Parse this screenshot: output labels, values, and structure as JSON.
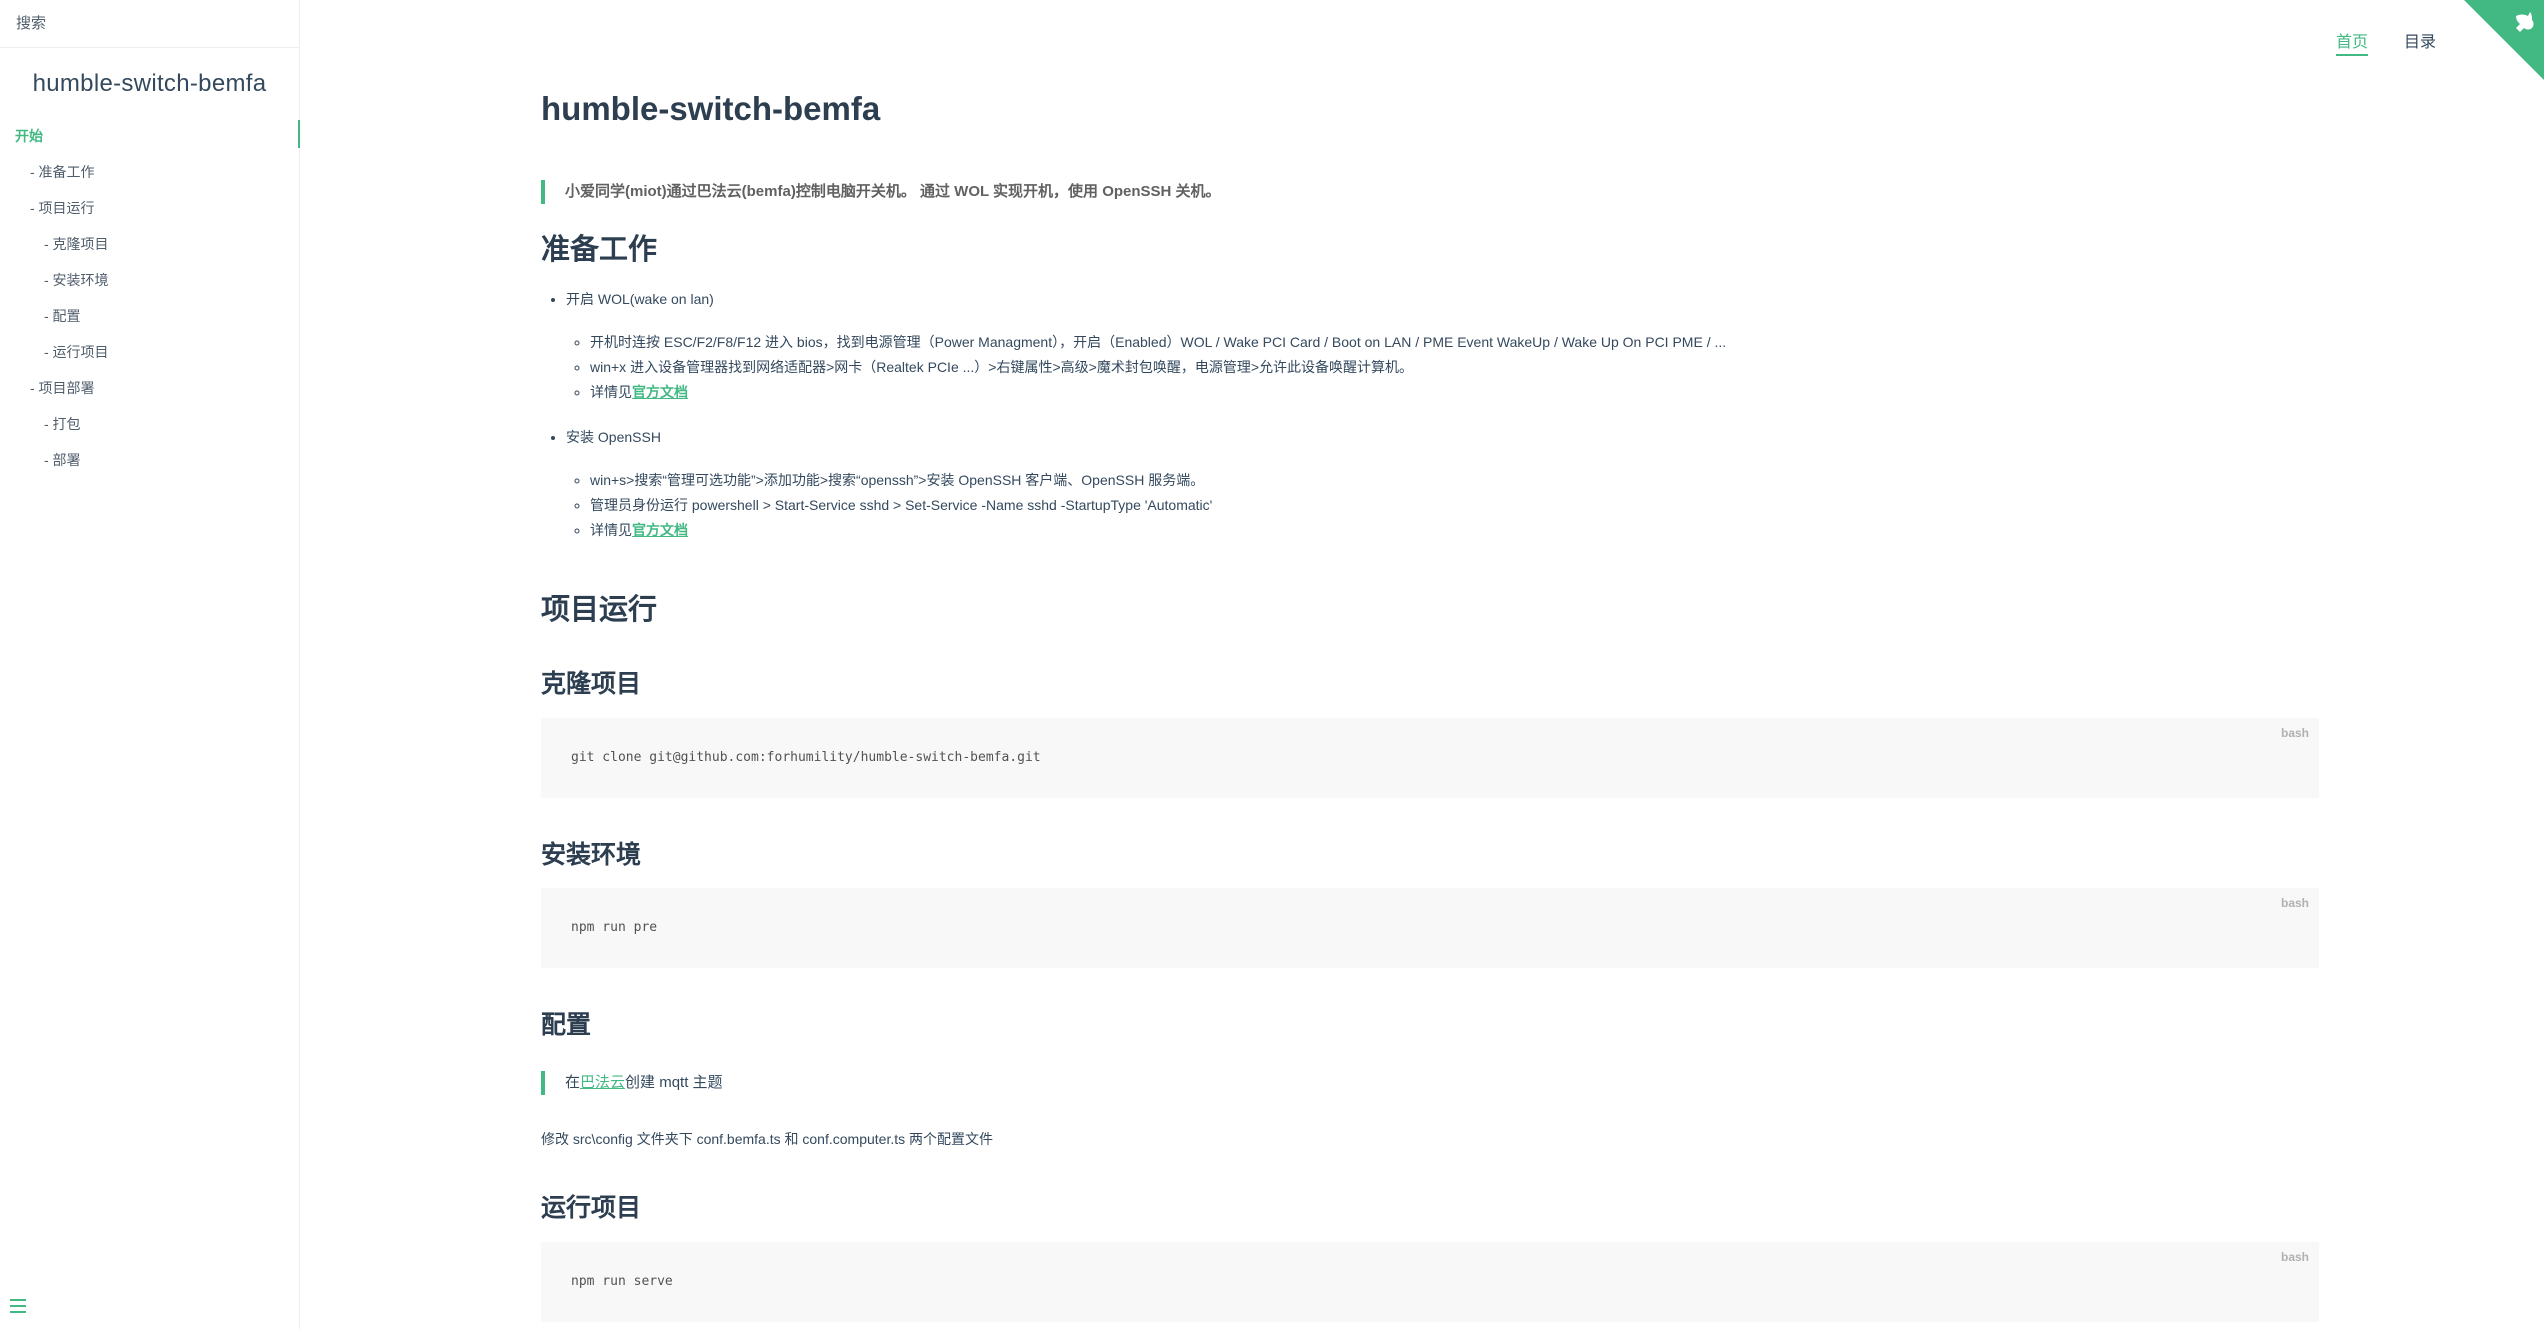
{
  "sidebar": {
    "search_placeholder": "搜索",
    "app_name": "humble-switch-bemfa",
    "toc": [
      {
        "label": "开始",
        "level": 0,
        "active": true
      },
      {
        "label": "- 准备工作",
        "level": 1
      },
      {
        "label": "- 项目运行",
        "level": 1
      },
      {
        "label": "- 克隆项目",
        "level": 2
      },
      {
        "label": "- 安装环境",
        "level": 2
      },
      {
        "label": "- 配置",
        "level": 2
      },
      {
        "label": "- 运行项目",
        "level": 2
      },
      {
        "label": "- 项目部署",
        "level": 1
      },
      {
        "label": "- 打包",
        "level": 2
      },
      {
        "label": "- 部署",
        "level": 2
      }
    ],
    "toggle_icon": "menu-icon"
  },
  "nav": {
    "home": "首页",
    "toc": "目录"
  },
  "accent_color": "#42b983",
  "content": {
    "title": "humble-switch-bemfa",
    "intro": "小爱同学(miot)通过巴法云(bemfa)控制电脑开关机。 通过 WOL 实现开机，使用 OpenSSH 关机。",
    "prep": {
      "heading": "准备工作",
      "wol": {
        "title": "开启 WOL(wake on lan)",
        "items": [
          "开机时连按 ESC/F2/F8/F12 进入 bios，找到电源管理（Power Managment），开启（Enabled）WOL / Wake PCI Card / Boot on LAN / PME Event WakeUp / Wake Up On PCI PME / ...",
          "win+x 进入设备管理器找到网络适配器>网卡（Realtek PCIe ...）>右键属性>高级>魔术封包唤醒，电源管理>允许此设备唤醒计算机。"
        ],
        "detail_prefix": "详情见",
        "detail_link": "官方文档"
      },
      "ssh": {
        "title": "安装 OpenSSH",
        "items": [
          "win+s>搜索“管理可选功能”>添加功能>搜索“openssh”>安装 OpenSSH 客户端、OpenSSH 服务端。",
          "管理员身份运行 powershell > Start-Service sshd > Set-Service -Name sshd -StartupType 'Automatic'"
        ],
        "detail_prefix": "详情见",
        "detail_link": "官方文档"
      }
    },
    "run": {
      "heading": "项目运行",
      "clone": {
        "heading": "克隆项目",
        "lang": "bash",
        "code": "git clone git@github.com:forhumility/humble-switch-bemfa.git"
      },
      "install": {
        "heading": "安装环境",
        "lang": "bash",
        "code": "npm run pre"
      },
      "config": {
        "heading": "配置",
        "quote_prefix": "在",
        "quote_link": "巴法云",
        "quote_suffix": "创建 mqtt 主题",
        "note": "修改 src\\config 文件夹下 conf.bemfa.ts 和 conf.computer.ts 两个配置文件"
      },
      "serve": {
        "heading": "运行项目",
        "lang": "bash",
        "code": "npm run serve"
      }
    }
  }
}
